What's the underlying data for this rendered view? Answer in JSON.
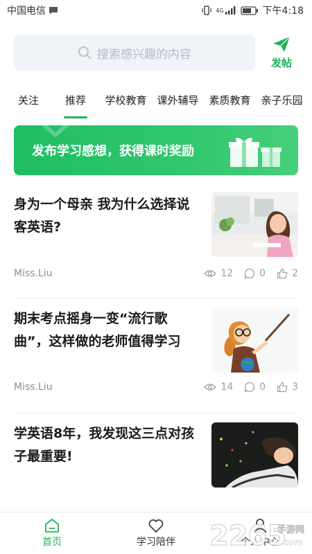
{
  "status_bar": {
    "carrier": "中国电信",
    "network": "4G",
    "time": "下午4:18"
  },
  "header": {
    "search_placeholder": "搜索感兴趣的内容",
    "post_label": "发帖"
  },
  "tabs": [
    {
      "label": "关注",
      "active": false
    },
    {
      "label": "推荐",
      "active": true
    },
    {
      "label": "学校教育",
      "active": false
    },
    {
      "label": "课外辅导",
      "active": false
    },
    {
      "label": "素质教育",
      "active": false
    },
    {
      "label": "亲子乐园",
      "active": false
    }
  ],
  "banner": {
    "text": "发布学习感想，获得课时奖励"
  },
  "articles": [
    {
      "title": "身为一个母亲 我为什么选择说客英语?",
      "author": "Miss.Liu",
      "views": "12",
      "comments": "0",
      "likes": "2",
      "thumb": "girl-studying"
    },
    {
      "title": "期末考点摇身一变“流行歌曲”，这样做的老师值得学习",
      "author": "Miss.Liu",
      "views": "14",
      "comments": "0",
      "likes": "3",
      "thumb": "teacher-cartoon"
    },
    {
      "title": "学英语8年，我发现这三点对孩子最重要!",
      "thumb": "woman-relaxing"
    }
  ],
  "bottom_nav": [
    {
      "label": "首页",
      "icon": "home-icon",
      "active": true
    },
    {
      "label": "学习陪伴",
      "icon": "heart-icon",
      "active": false
    },
    {
      "label": "个人中心",
      "icon": "person-icon",
      "active": false
    }
  ],
  "watermark": {
    "brand": "2265",
    "sub": "手游网",
    "domain": ".com"
  },
  "colors": {
    "accent": "#20b25b",
    "search_bg": "#f0f3f8",
    "meta_text": "#8a8f96"
  }
}
